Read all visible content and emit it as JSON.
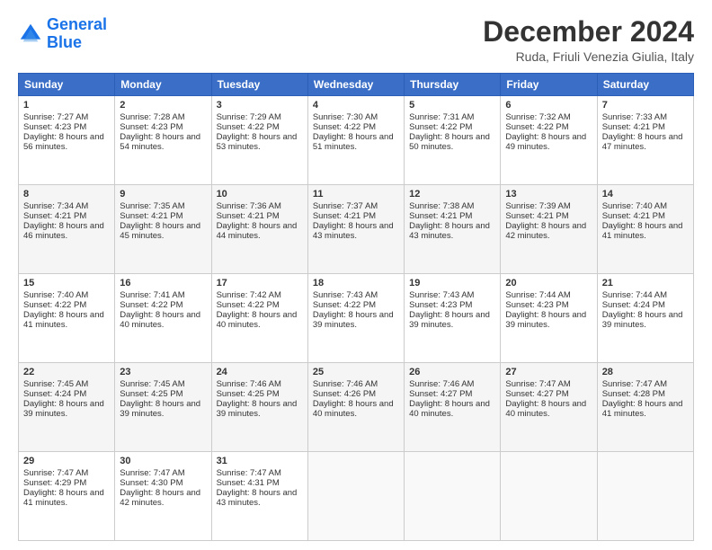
{
  "logo": {
    "line1": "General",
    "line2": "Blue"
  },
  "header": {
    "title": "December 2024",
    "subtitle": "Ruda, Friuli Venezia Giulia, Italy"
  },
  "weekdays": [
    "Sunday",
    "Monday",
    "Tuesday",
    "Wednesday",
    "Thursday",
    "Friday",
    "Saturday"
  ],
  "weeks": [
    [
      {
        "day": "1",
        "sunrise": "7:27 AM",
        "sunset": "4:23 PM",
        "daylight": "8 hours and 56 minutes."
      },
      {
        "day": "2",
        "sunrise": "7:28 AM",
        "sunset": "4:23 PM",
        "daylight": "8 hours and 54 minutes."
      },
      {
        "day": "3",
        "sunrise": "7:29 AM",
        "sunset": "4:22 PM",
        "daylight": "8 hours and 53 minutes."
      },
      {
        "day": "4",
        "sunrise": "7:30 AM",
        "sunset": "4:22 PM",
        "daylight": "8 hours and 51 minutes."
      },
      {
        "day": "5",
        "sunrise": "7:31 AM",
        "sunset": "4:22 PM",
        "daylight": "8 hours and 50 minutes."
      },
      {
        "day": "6",
        "sunrise": "7:32 AM",
        "sunset": "4:22 PM",
        "daylight": "8 hours and 49 minutes."
      },
      {
        "day": "7",
        "sunrise": "7:33 AM",
        "sunset": "4:21 PM",
        "daylight": "8 hours and 47 minutes."
      }
    ],
    [
      {
        "day": "8",
        "sunrise": "7:34 AM",
        "sunset": "4:21 PM",
        "daylight": "8 hours and 46 minutes."
      },
      {
        "day": "9",
        "sunrise": "7:35 AM",
        "sunset": "4:21 PM",
        "daylight": "8 hours and 45 minutes."
      },
      {
        "day": "10",
        "sunrise": "7:36 AM",
        "sunset": "4:21 PM",
        "daylight": "8 hours and 44 minutes."
      },
      {
        "day": "11",
        "sunrise": "7:37 AM",
        "sunset": "4:21 PM",
        "daylight": "8 hours and 43 minutes."
      },
      {
        "day": "12",
        "sunrise": "7:38 AM",
        "sunset": "4:21 PM",
        "daylight": "8 hours and 43 minutes."
      },
      {
        "day": "13",
        "sunrise": "7:39 AM",
        "sunset": "4:21 PM",
        "daylight": "8 hours and 42 minutes."
      },
      {
        "day": "14",
        "sunrise": "7:40 AM",
        "sunset": "4:21 PM",
        "daylight": "8 hours and 41 minutes."
      }
    ],
    [
      {
        "day": "15",
        "sunrise": "7:40 AM",
        "sunset": "4:22 PM",
        "daylight": "8 hours and 41 minutes."
      },
      {
        "day": "16",
        "sunrise": "7:41 AM",
        "sunset": "4:22 PM",
        "daylight": "8 hours and 40 minutes."
      },
      {
        "day": "17",
        "sunrise": "7:42 AM",
        "sunset": "4:22 PM",
        "daylight": "8 hours and 40 minutes."
      },
      {
        "day": "18",
        "sunrise": "7:43 AM",
        "sunset": "4:22 PM",
        "daylight": "8 hours and 39 minutes."
      },
      {
        "day": "19",
        "sunrise": "7:43 AM",
        "sunset": "4:23 PM",
        "daylight": "8 hours and 39 minutes."
      },
      {
        "day": "20",
        "sunrise": "7:44 AM",
        "sunset": "4:23 PM",
        "daylight": "8 hours and 39 minutes."
      },
      {
        "day": "21",
        "sunrise": "7:44 AM",
        "sunset": "4:24 PM",
        "daylight": "8 hours and 39 minutes."
      }
    ],
    [
      {
        "day": "22",
        "sunrise": "7:45 AM",
        "sunset": "4:24 PM",
        "daylight": "8 hours and 39 minutes."
      },
      {
        "day": "23",
        "sunrise": "7:45 AM",
        "sunset": "4:25 PM",
        "daylight": "8 hours and 39 minutes."
      },
      {
        "day": "24",
        "sunrise": "7:46 AM",
        "sunset": "4:25 PM",
        "daylight": "8 hours and 39 minutes."
      },
      {
        "day": "25",
        "sunrise": "7:46 AM",
        "sunset": "4:26 PM",
        "daylight": "8 hours and 40 minutes."
      },
      {
        "day": "26",
        "sunrise": "7:46 AM",
        "sunset": "4:27 PM",
        "daylight": "8 hours and 40 minutes."
      },
      {
        "day": "27",
        "sunrise": "7:47 AM",
        "sunset": "4:27 PM",
        "daylight": "8 hours and 40 minutes."
      },
      {
        "day": "28",
        "sunrise": "7:47 AM",
        "sunset": "4:28 PM",
        "daylight": "8 hours and 41 minutes."
      }
    ],
    [
      {
        "day": "29",
        "sunrise": "7:47 AM",
        "sunset": "4:29 PM",
        "daylight": "8 hours and 41 minutes."
      },
      {
        "day": "30",
        "sunrise": "7:47 AM",
        "sunset": "4:30 PM",
        "daylight": "8 hours and 42 minutes."
      },
      {
        "day": "31",
        "sunrise": "7:47 AM",
        "sunset": "4:31 PM",
        "daylight": "8 hours and 43 minutes."
      },
      null,
      null,
      null,
      null
    ]
  ]
}
